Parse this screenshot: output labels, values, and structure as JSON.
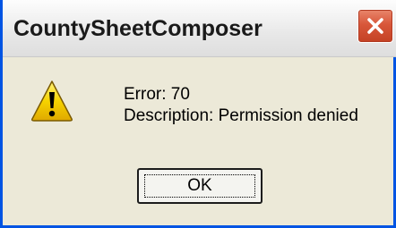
{
  "window": {
    "title": "CountySheetComposer",
    "close_icon": "close-icon",
    "accent_color": "#0054e3",
    "close_color": "#d8573a"
  },
  "dialog": {
    "icon": "warning-icon",
    "icon_color": "#f6d300",
    "error_line": "Error: 70",
    "description_line": "Description: Permission denied",
    "ok_label": "OK"
  }
}
